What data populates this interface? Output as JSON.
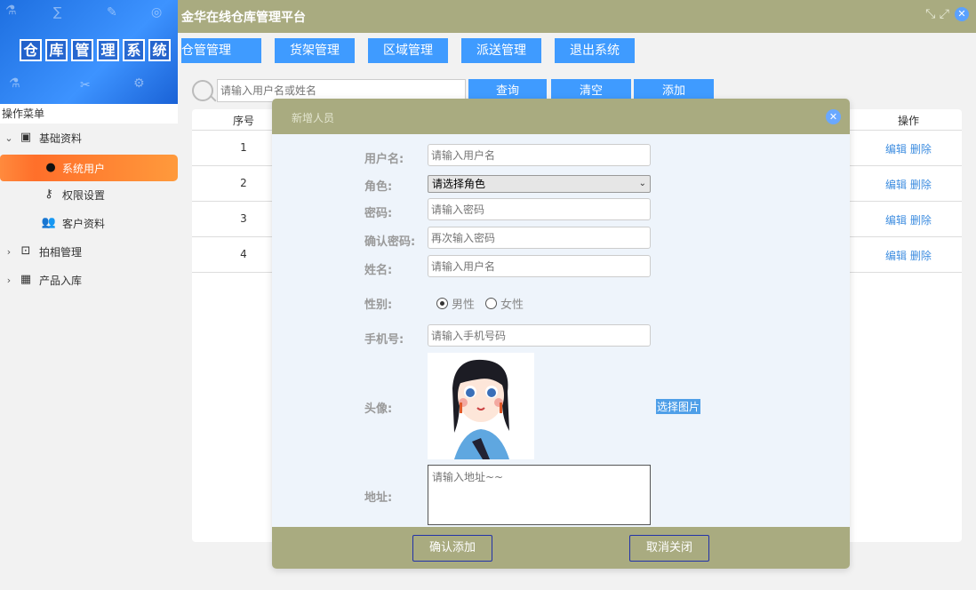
{
  "app": {
    "title": "金华在线仓库管理平台",
    "logo_text": [
      "仓",
      "库",
      "管",
      "理",
      "系",
      "统"
    ]
  },
  "nav": {
    "items": [
      "仓管管理",
      "货架管理",
      "区域管理",
      "派送管理",
      "退出系统"
    ]
  },
  "search": {
    "placeholder": "请输入用户名或姓名",
    "search_label": "查询",
    "clear_label": "清空",
    "add_label": "添加"
  },
  "sidebar": {
    "header": "操作菜单",
    "items": [
      {
        "label": "基础资料",
        "icon": "archive-icon"
      },
      {
        "label": "系统用户",
        "icon": "user-icon"
      },
      {
        "label": "权限设置",
        "icon": "user-key-icon"
      },
      {
        "label": "客户资料",
        "icon": "users-icon"
      },
      {
        "label": "拍相管理",
        "icon": "portrait-icon"
      },
      {
        "label": "产品入库",
        "icon": "grid-icon"
      }
    ]
  },
  "table": {
    "col_no": "序号",
    "col_op": "操作",
    "rows": [
      {
        "no": "1",
        "edit": "编辑",
        "del": "删除"
      },
      {
        "no": "2",
        "edit": "编辑",
        "del": "删除"
      },
      {
        "no": "3",
        "edit": "编辑",
        "del": "删除"
      },
      {
        "no": "4",
        "edit": "编辑",
        "del": "删除"
      }
    ]
  },
  "modal": {
    "title": "新增人员",
    "username_label": "用户名:",
    "username_placeholder": "请输入用户名",
    "role_label": "角色:",
    "role_value": "请选择角色",
    "password_label": "密码:",
    "password_placeholder": "请输入密码",
    "confirm_label": "确认密码:",
    "confirm_placeholder": "再次输入密码",
    "name_label": "姓名:",
    "name_placeholder": "请输入用户名",
    "gender_label": "性别:",
    "gender_male": "男性",
    "gender_female": "女性",
    "phone_label": "手机号:",
    "phone_placeholder": "请输入手机号码",
    "avatar_label": "头像:",
    "pick_label": "选择图片",
    "address_label": "地址:",
    "address_placeholder": "请输入地址~~",
    "confirm_button": "确认添加",
    "cancel_button": "取消关闭"
  },
  "colors": {
    "accent": "#3f9bff",
    "topbar": "#a9ab80",
    "active": "#ff7a2f"
  }
}
